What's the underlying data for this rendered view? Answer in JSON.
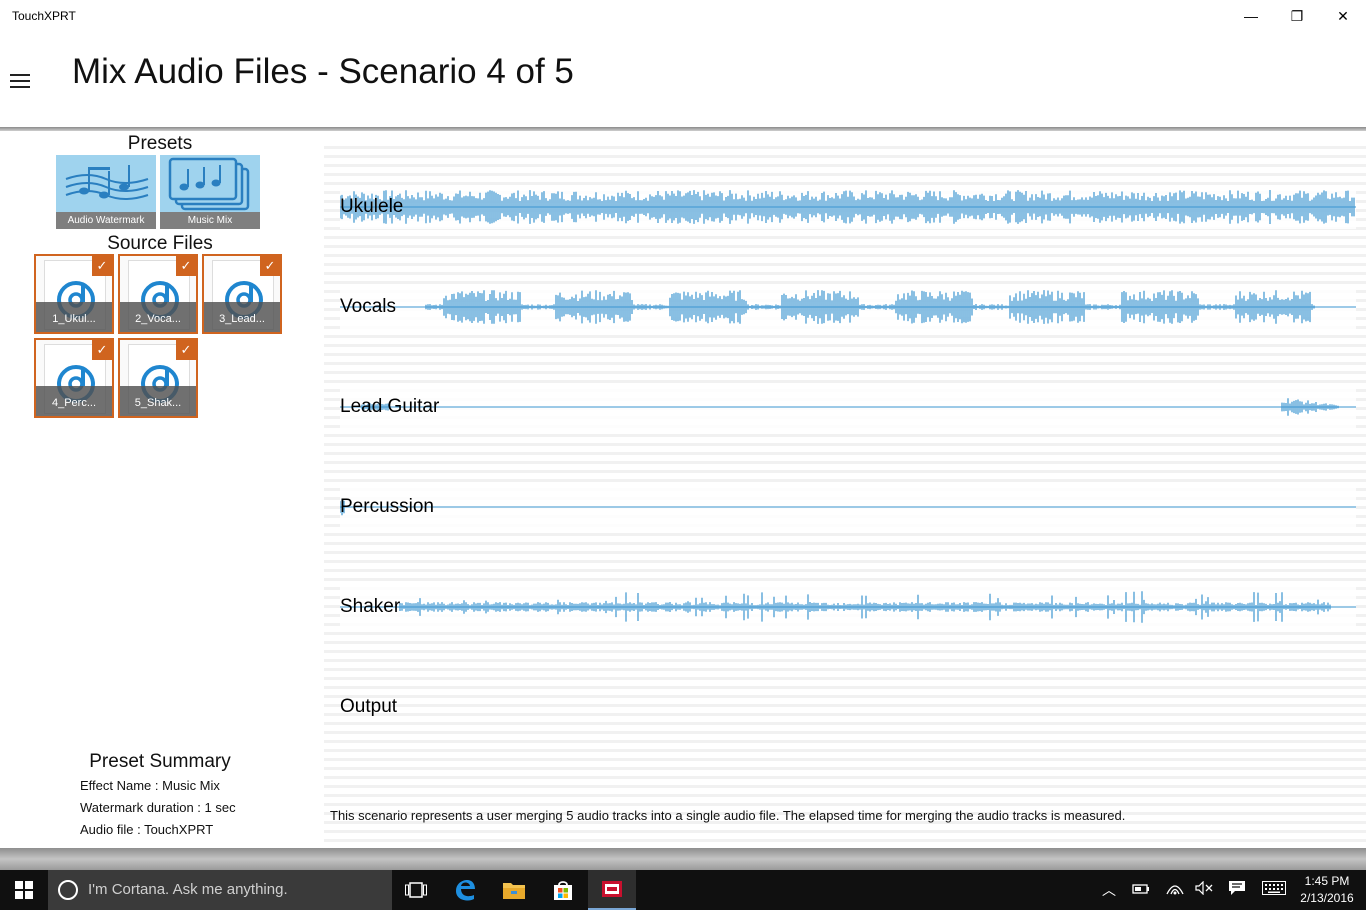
{
  "window": {
    "title": "TouchXPRT",
    "minimize_glyph": "—",
    "restore_glyph": "❐",
    "close_glyph": "✕"
  },
  "header": {
    "page_title": "Mix Audio Files - Scenario 4 of 5",
    "menu_icon": "hamburger-icon"
  },
  "presets": {
    "title": "Presets",
    "items": [
      {
        "label": "Audio Watermark",
        "icon": "music-staff-icon"
      },
      {
        "label": "Music Mix",
        "icon": "music-notes-stack-icon"
      }
    ]
  },
  "source_files": {
    "title": "Source Files",
    "items": [
      {
        "label": "1_Ukul...",
        "checked": true
      },
      {
        "label": "2_Voca...",
        "checked": true
      },
      {
        "label": "3_Lead...",
        "checked": true
      },
      {
        "label": "4_Perc...",
        "checked": true
      },
      {
        "label": "5_Shak...",
        "checked": true
      }
    ],
    "check_glyph": "✓"
  },
  "summary": {
    "title": "Preset Summary",
    "effect": "Effect Name : Music Mix",
    "watermark": "Watermark duration : 1 sec",
    "audio_file": "Audio file : TouchXPRT"
  },
  "tracks": [
    {
      "name": "Ukulele"
    },
    {
      "name": "Vocals"
    },
    {
      "name": "Lead Guitar"
    },
    {
      "name": "Percussion"
    },
    {
      "name": "Shaker"
    },
    {
      "name": "Output"
    }
  ],
  "description": "This scenario represents a user merging 5 audio tracks into a single audio file. The elapsed time for merging the audio tracks is measured.",
  "colors": {
    "accent": "#d0641f",
    "waveform": "#3b95d0",
    "preset_tile": "#9fd3ee"
  },
  "taskbar": {
    "search_placeholder": "I'm Cortana. Ask me anything.",
    "time": "1:45 PM",
    "date": "2/13/2016",
    "icons": [
      "windows-start-icon",
      "task-view-icon",
      "edge-icon",
      "file-explorer-icon",
      "store-icon",
      "touchxprt-icon"
    ],
    "tray_icons": [
      "chevron-up-icon",
      "battery-icon",
      "wifi-icon",
      "volume-muted-icon",
      "notifications-icon",
      "keyboard-icon"
    ]
  }
}
